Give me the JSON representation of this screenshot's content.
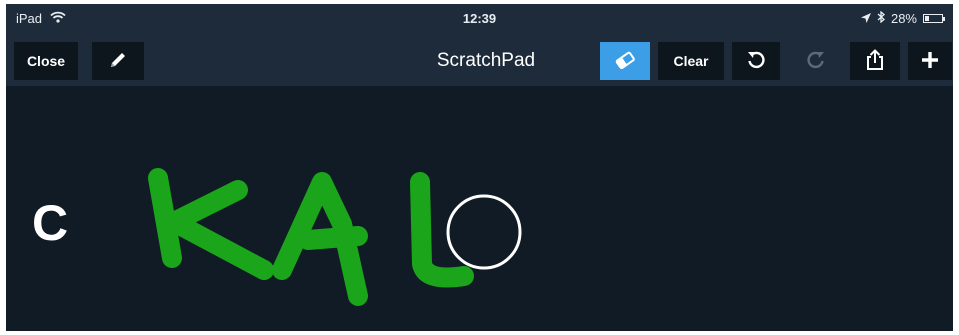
{
  "status_bar": {
    "device": "iPad",
    "time": "12:39",
    "battery": "28%",
    "battery_level": 0.28,
    "icons": [
      "wifi-icon",
      "location-arrow-icon",
      "bluetooth-icon",
      "battery-icon"
    ]
  },
  "toolbar": {
    "close_label": "Close",
    "title": "ScratchPad",
    "clear_label": "Clear",
    "active_tool": "eraser",
    "icons": [
      "pencil-icon",
      "eraser-icon",
      "undo-icon",
      "redo-icon",
      "share-icon",
      "plus-icon"
    ]
  },
  "canvas": {
    "typed_text": "C",
    "drawing_color": "#1aa51a",
    "cursor_icon": "eraser-cursor-icon"
  },
  "colors": {
    "background": "#111b25",
    "bar": "#1d2b3b",
    "button": "#0d151d",
    "accent": "#3b9ee6"
  }
}
